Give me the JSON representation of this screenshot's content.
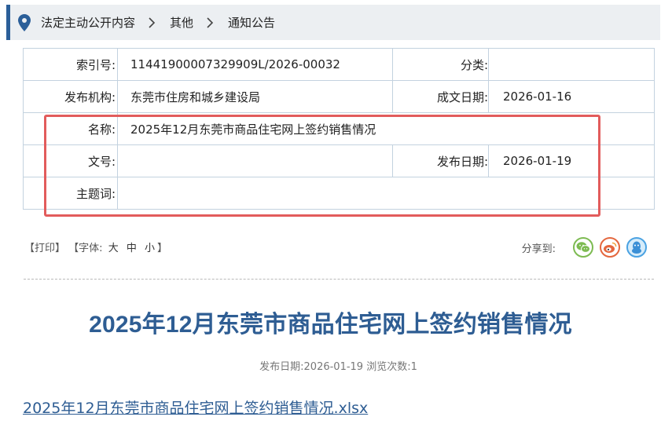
{
  "breadcrumb": {
    "items": [
      "法定主动公开内容",
      "其他",
      "通知公告"
    ]
  },
  "info": {
    "index_label": "索引号:",
    "index_value": "11441900007329909L/2026-00032",
    "category_label": "分类:",
    "category_value": "",
    "publisher_label": "发布机构:",
    "publisher_value": "东莞市住房和城乡建设局",
    "created_label": "成文日期:",
    "created_value": "2026-01-16",
    "name_label": "名称:",
    "name_value": "2025年12月东莞市商品住宅网上签约销售情况",
    "docno_label": "文号:",
    "docno_value": "",
    "pubdate_label": "发布日期:",
    "pubdate_value": "2026-01-19",
    "subject_label": "主题词:",
    "subject_value": ""
  },
  "tools": {
    "print": "【打印】",
    "font_open": "【字体:",
    "font_large": "大",
    "font_medium": "中",
    "font_small": "小",
    "font_close": "】",
    "share_label": "分享到:"
  },
  "article": {
    "title": "2025年12月东莞市商品住宅网上签约销售情况",
    "meta": "发布日期:2026-01-19  浏览次数:1",
    "attachment": "2025年12月东莞市商品住宅网上签约销售情况.xlsx"
  },
  "colors": {
    "accent": "#2e5d93",
    "highlight": "#e25c5c",
    "wechat": "#7dbb52",
    "weibo": "#e4673e",
    "qq": "#4aa2e2"
  }
}
